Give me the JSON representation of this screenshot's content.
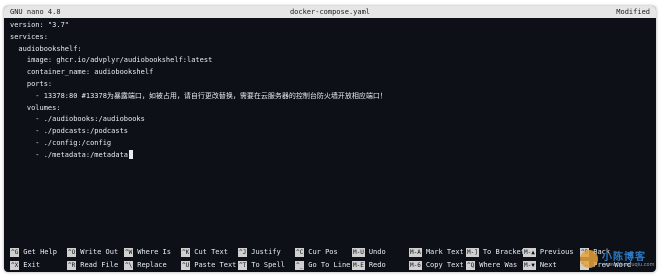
{
  "titlebar": {
    "app": "GNU nano 4.8",
    "filename": "docker-compose.yaml",
    "status": "Modified"
  },
  "editor": {
    "lines": [
      "version: \"3.7\"",
      "services:",
      "  audiobookshelf:",
      "    image: ghcr.io/advplyr/audiobookshelf:latest",
      "    container_name: audiobookshelf",
      "    ports:",
      "      - 13378:80 #13378为暴露端口，如被占用，请自行更改替换，需要在云服务器的控制台防火墙开放相应端口！",
      "    volumes:",
      "      - ./audiobooks:/audiobooks",
      "      - ./podcasts:/podcasts",
      "      - ./config:/config",
      "      - ./metadata:/metadata"
    ]
  },
  "shortcuts": {
    "row1": [
      {
        "key": "^G",
        "label": "Get Help"
      },
      {
        "key": "^O",
        "label": "Write Out"
      },
      {
        "key": "^W",
        "label": "Where Is"
      },
      {
        "key": "^K",
        "label": "Cut Text"
      },
      {
        "key": "^J",
        "label": "Justify"
      },
      {
        "key": "^C",
        "label": "Cur Pos"
      },
      {
        "key": "M-U",
        "label": "Undo"
      },
      {
        "key": "M-A",
        "label": "Mark Text"
      },
      {
        "key": "M-]",
        "label": "To Bracket"
      },
      {
        "key": "M-▲",
        "label": "Previous"
      },
      {
        "key": "^B",
        "label": "Back"
      }
    ],
    "row2": [
      {
        "key": "^X",
        "label": "Exit"
      },
      {
        "key": "^R",
        "label": "Read File"
      },
      {
        "key": "^\\",
        "label": "Replace"
      },
      {
        "key": "^U",
        "label": "Paste Text"
      },
      {
        "key": "^T",
        "label": "To Spell"
      },
      {
        "key": "^_",
        "label": "Go To Line"
      },
      {
        "key": "M-E",
        "label": "Redo"
      },
      {
        "key": "M-6",
        "label": "Copy Text"
      },
      {
        "key": "^Q",
        "label": "Where Was"
      },
      {
        "key": "M-▼",
        "label": "Next"
      },
      {
        "key": "^←",
        "label": "Prev Word"
      }
    ]
  },
  "watermark": {
    "title": "小陈博客",
    "subtitle": "www.chenfuqiu.com"
  },
  "colors": {
    "terminal_bg": "#0d1117",
    "terminal_fg": "#e6edf3",
    "titlebar_bg": "#e6e6e6",
    "key_bg": "#d0d0d0"
  }
}
